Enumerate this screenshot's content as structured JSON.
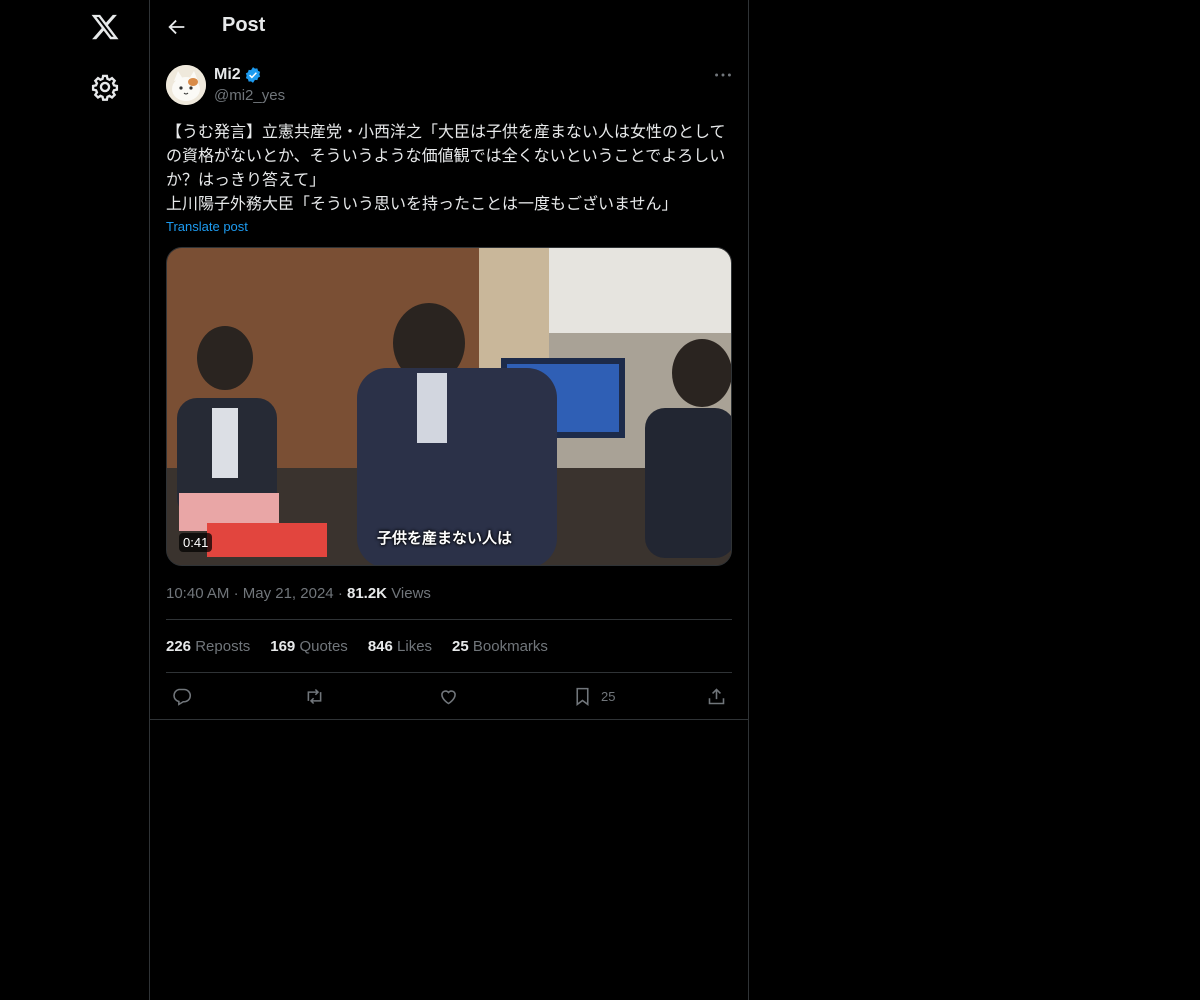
{
  "header": {
    "title": "Post"
  },
  "author": {
    "name": "Mi2",
    "handle": "@mi2_yes"
  },
  "post": {
    "text": "【うむ発言】立憲共産党・小西洋之「大臣は子供を産まない人は女性のとしての資格がないとか、そういうような価値観では全くないということでよろしいか？はっきり答えて」\n上川陽子外務大臣「そういう思いを持ったことは一度もございません」",
    "translate_label": "Translate post",
    "video": {
      "duration": "0:41",
      "caption": "子供を産まない人は"
    },
    "time": "10:40 AM",
    "date": "May 21, 2024",
    "sep": "·",
    "views_count": "81.2K",
    "views_label": "Views"
  },
  "stats": {
    "reposts": "226",
    "reposts_label": "Reposts",
    "quotes": "169",
    "quotes_label": "Quotes",
    "likes": "846",
    "likes_label": "Likes",
    "bookmarks": "25",
    "bookmarks_label": "Bookmarks"
  },
  "actions": {
    "bookmark_count": "25"
  },
  "icons": [
    "x-logo-icon",
    "gear-icon",
    "back-arrow-icon",
    "verified-badge-icon",
    "more-icon",
    "reply-icon",
    "repost-icon",
    "like-icon",
    "bookmark-icon",
    "share-icon"
  ],
  "colors": {
    "accent": "#1d9bf0",
    "muted": "#71767b",
    "border": "#2f3336",
    "background": "#000000"
  }
}
